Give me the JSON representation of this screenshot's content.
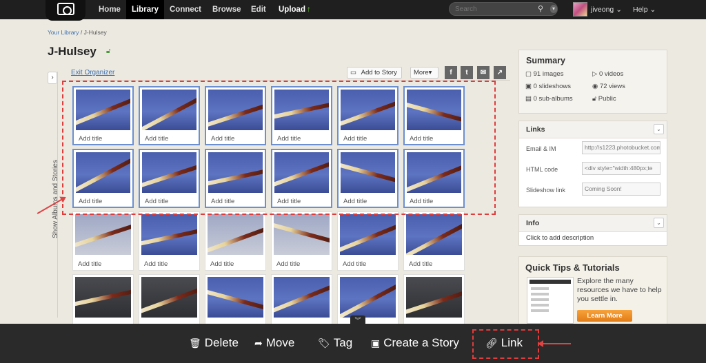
{
  "nav": {
    "items": [
      "Home",
      "Library",
      "Connect",
      "Browse",
      "Edit",
      "Upload"
    ],
    "active": "Library",
    "search_placeholder": "Search",
    "username": "jiveong",
    "help": "Help"
  },
  "breadcrumb": {
    "root": "Your Library",
    "separator": "/",
    "current": "J-Hulsey"
  },
  "album": {
    "title": "J-Hulsey"
  },
  "side_tab": {
    "label": "Show Albums and Stories"
  },
  "toolbar": {
    "exit_label": "Exit Organizer",
    "add_story_label": "Add to Story",
    "more_label": "More",
    "social_icons": [
      "facebook-icon",
      "twitter-icon",
      "email-icon",
      "share-icon"
    ]
  },
  "grid": {
    "caption": "Add title",
    "rows": [
      {
        "selected": true,
        "items": [
          "blue",
          "blue",
          "blue",
          "blue",
          "blue",
          "blue"
        ]
      },
      {
        "selected": true,
        "items": [
          "blue",
          "blue",
          "blue",
          "blue",
          "blue",
          "blue"
        ]
      },
      {
        "selected": false,
        "items": [
          "pale",
          "blue",
          "pale",
          "pale",
          "blue",
          "blue"
        ]
      },
      {
        "selected": false,
        "items": [
          "dark",
          "dark",
          "blue",
          "blue",
          "blue",
          "dark"
        ]
      }
    ]
  },
  "summary": {
    "title": "Summary",
    "images": "91 images",
    "videos": "0 videos",
    "slideshows": "0 slideshows",
    "views": "72 views",
    "subalbums": "0 sub-albums",
    "privacy": "Public"
  },
  "links": {
    "title": "Links",
    "email_label": "Email & IM",
    "email_value": "http://s1223.photobucket.com",
    "html_label": "HTML code",
    "html_value": "<div style=\"width:480px;te",
    "slideshow_label": "Slideshow link",
    "slideshow_value": "Coming Soon!"
  },
  "info": {
    "title": "Info",
    "description_prompt": "Click to add description"
  },
  "tips": {
    "title": "Quick Tips & Tutorials",
    "text": "Explore the many resources we have to help you settle in.",
    "button": "Learn More"
  },
  "bottom_actions": {
    "delete": "Delete",
    "move": "Move",
    "tag": "Tag",
    "create_story": "Create a Story",
    "link": "Link"
  },
  "colors": {
    "topbar": "#1f1f1f",
    "page_bg": "#ece9e1",
    "selection": "#6b8fd0",
    "annotation": "#e03c3c",
    "accent_green": "#6cc33c",
    "button_orange": "#f08b26"
  }
}
